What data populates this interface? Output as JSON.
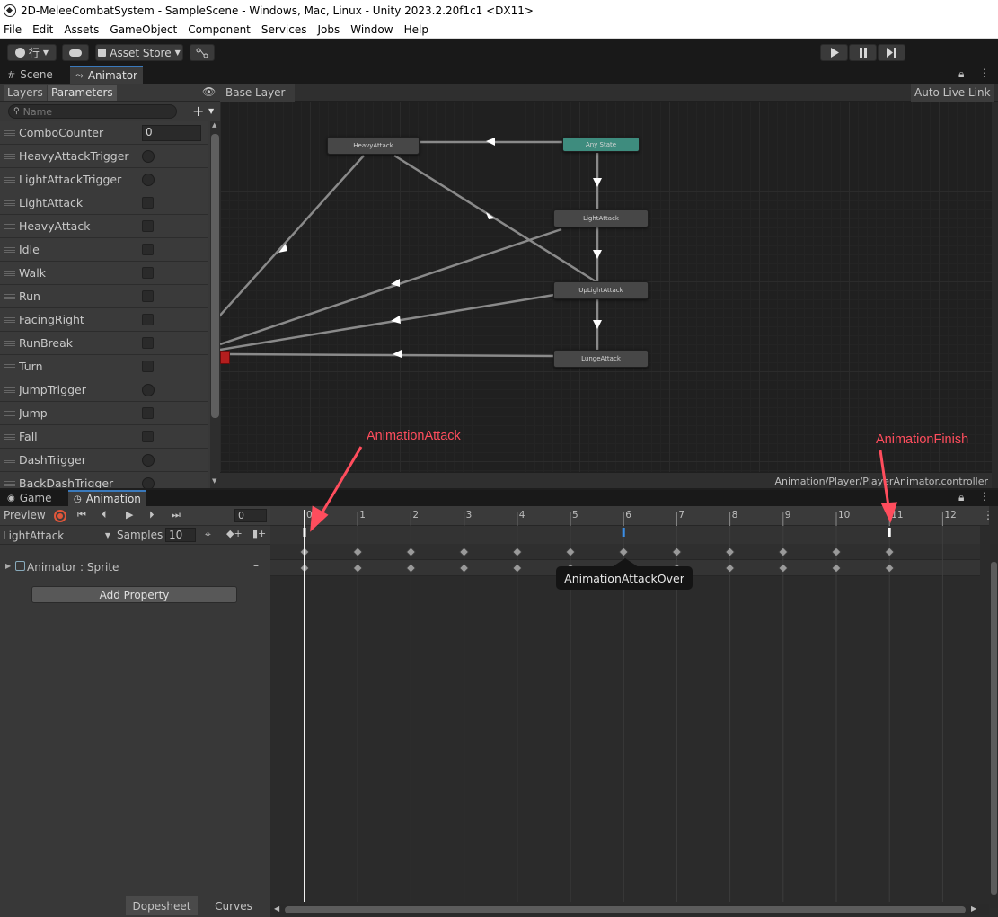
{
  "window": {
    "title": "2D-MeleeCombatSystem - SampleScene - Windows, Mac, Linux - Unity 2023.2.20f1c1 <DX11>"
  },
  "menu": [
    "File",
    "Edit",
    "Assets",
    "GameObject",
    "Component",
    "Services",
    "Jobs",
    "Window",
    "Help"
  ],
  "toolbar": {
    "account_label": "行",
    "asset_store_label": "Asset Store"
  },
  "top_tabs": {
    "scene": "Scene",
    "animator": "Animator"
  },
  "animator": {
    "subtabs": {
      "layers": "Layers",
      "parameters": "Parameters"
    },
    "search_placeholder": "Name",
    "breadcrumb": "Base Layer",
    "auto_live_link": "Auto Live Link",
    "footer_path": "Animation/Player/PlayerAnimator.controller",
    "parameters": [
      {
        "name": "ComboCounter",
        "type": "int",
        "value": "0"
      },
      {
        "name": "HeavyAttackTrigger",
        "type": "trigger"
      },
      {
        "name": "LightAttackTrigger",
        "type": "trigger"
      },
      {
        "name": "LightAttack",
        "type": "bool"
      },
      {
        "name": "HeavyAttack",
        "type": "bool"
      },
      {
        "name": "Idle",
        "type": "bool"
      },
      {
        "name": "Walk",
        "type": "bool"
      },
      {
        "name": "Run",
        "type": "bool"
      },
      {
        "name": "FacingRight",
        "type": "bool"
      },
      {
        "name": "RunBreak",
        "type": "bool"
      },
      {
        "name": "Turn",
        "type": "bool"
      },
      {
        "name": "JumpTrigger",
        "type": "trigger"
      },
      {
        "name": "Jump",
        "type": "bool"
      },
      {
        "name": "Fall",
        "type": "bool"
      },
      {
        "name": "DashTrigger",
        "type": "trigger"
      },
      {
        "name": "BackDashTrigger",
        "type": "trigger"
      }
    ],
    "states": {
      "heavy": "HeavyAttack",
      "any": "Any State",
      "light": "LightAttack",
      "uplight": "UpLightAttack",
      "lunge": "LungeAttack"
    }
  },
  "bottom_tabs": {
    "game": "Game",
    "animation": "Animation"
  },
  "animation": {
    "preview_label": "Preview",
    "frame_value": "0",
    "clip_name": "LightAttack",
    "samples_label": "Samples",
    "samples_value": "10",
    "property_label": "Animator : Sprite",
    "add_property": "Add Property",
    "dopesheet": "Dopesheet",
    "curves": "Curves",
    "ruler": [
      "0",
      "1",
      "2",
      "3",
      "4",
      "5",
      "6",
      "7",
      "8",
      "9",
      "10",
      "11",
      "12"
    ],
    "event_tooltip": "AnimationAttackOver"
  },
  "annotations": {
    "attack": "AnimationAttack",
    "finish": "AnimationFinish"
  },
  "colors": {
    "any_state": "#3e8c7e",
    "exit_node": "#b41e1e",
    "annotation": "#ff4d5d",
    "event_marker_blue": "#3a8ee6",
    "record": "#e0563a"
  }
}
